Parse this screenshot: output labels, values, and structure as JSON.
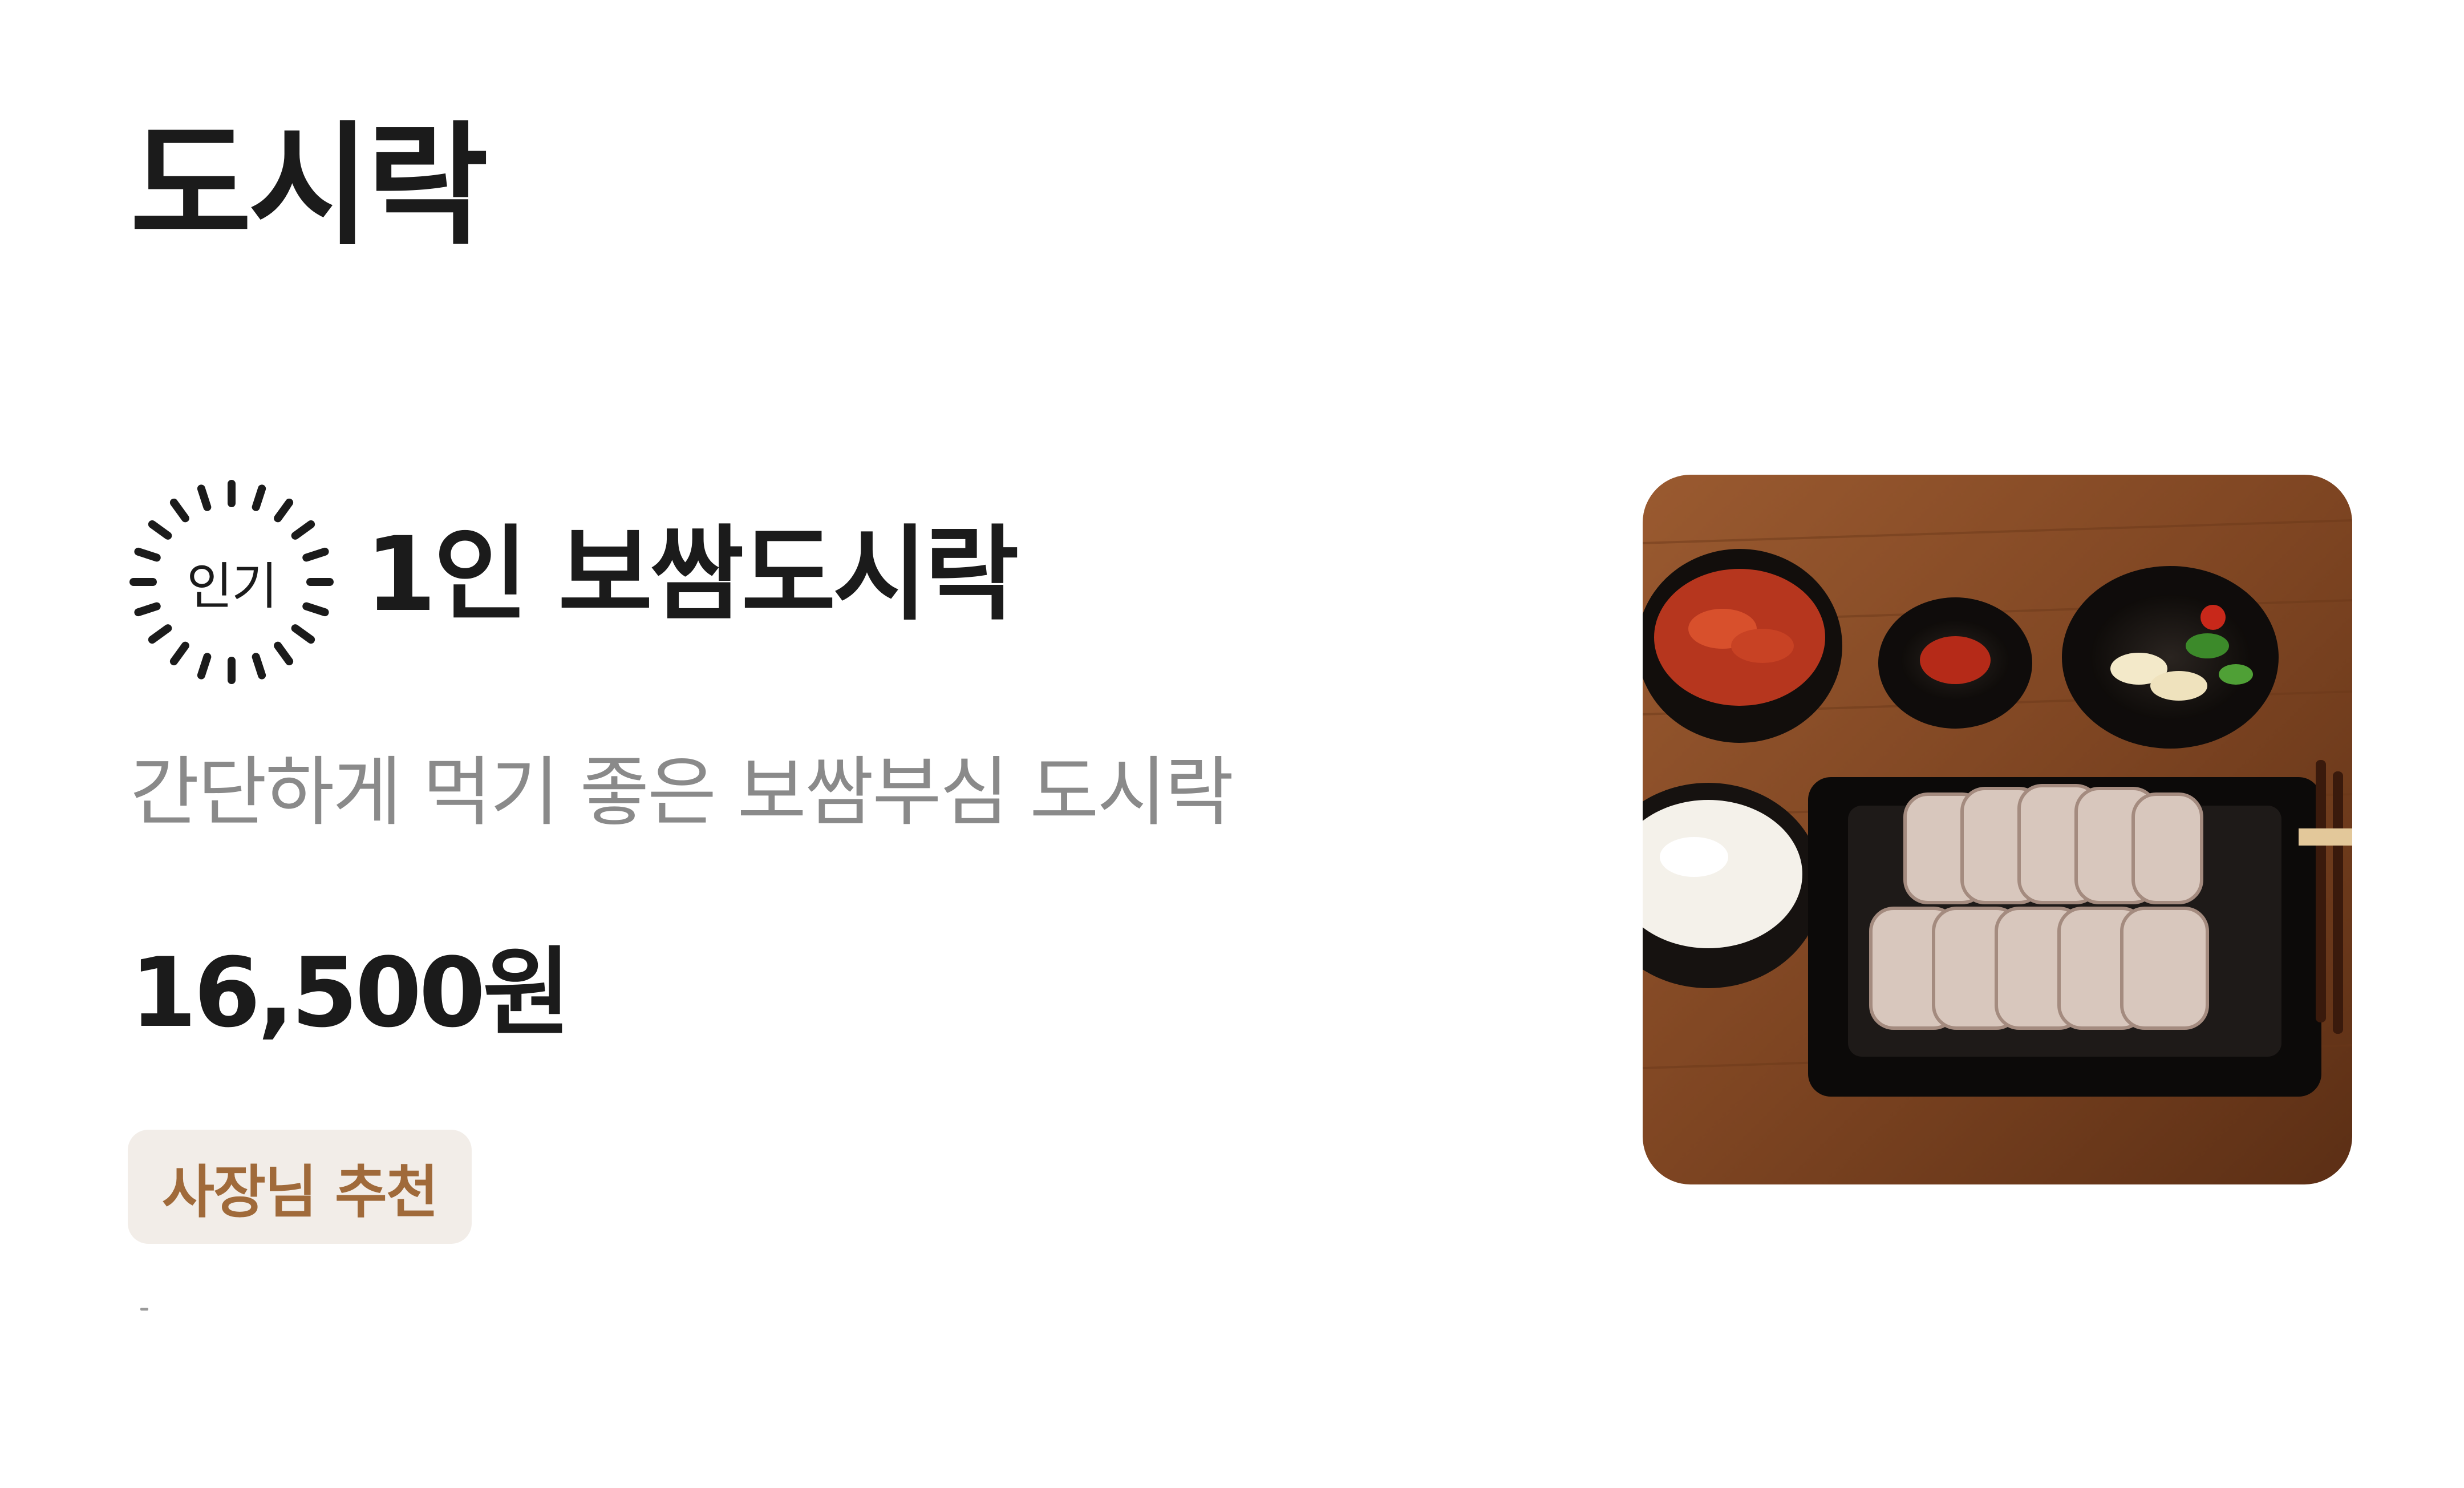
{
  "section": {
    "title": "도시락"
  },
  "menu_item": {
    "badge_label": "인기",
    "name": "1인 보쌈도시락",
    "description": "간단하게 먹기 좋은 보쌈부심 도시락",
    "price": "16,500원",
    "tag": "사장님 추천",
    "photo_icon": "food-photo"
  },
  "colors": {
    "text_primary": "#1b1b1b",
    "text_secondary": "#8a8a8a",
    "tag_background": "#f2ede8",
    "tag_text": "#a06a3a"
  }
}
